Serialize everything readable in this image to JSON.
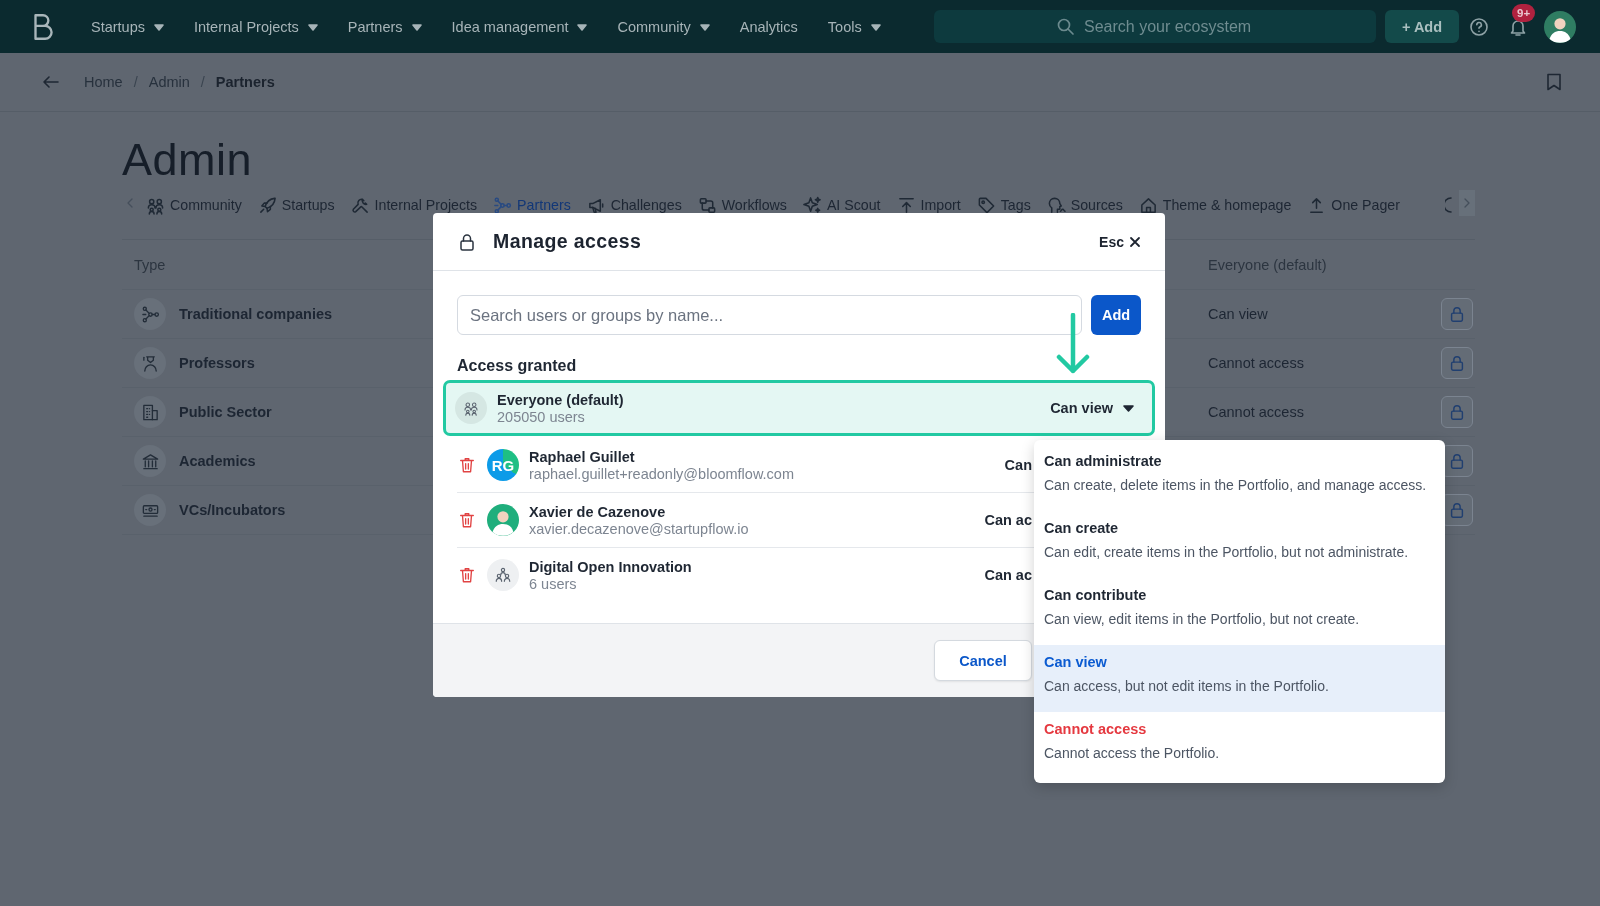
{
  "nav": {
    "menu": [
      {
        "label": "Startups",
        "dropdown": true
      },
      {
        "label": "Internal Projects",
        "dropdown": true
      },
      {
        "label": "Partners",
        "dropdown": true
      },
      {
        "label": "Idea management",
        "dropdown": true
      },
      {
        "label": "Community",
        "dropdown": true
      },
      {
        "label": "Analytics",
        "dropdown": false
      },
      {
        "label": "Tools",
        "dropdown": true
      }
    ],
    "search": {
      "placeholder": "Search your ecosystem"
    },
    "add_button": "+ Add",
    "notification_badge": "9+"
  },
  "breadcrumb": [
    {
      "label": "Home",
      "kind": "link"
    },
    {
      "label": "/",
      "kind": "separator"
    },
    {
      "label": "Admin",
      "kind": "link"
    },
    {
      "label": "/",
      "kind": "separator"
    },
    {
      "label": "Partners",
      "kind": "current"
    }
  ],
  "page_title": "Admin",
  "tabs": [
    {
      "label": "Community",
      "selected": false
    },
    {
      "label": "Startups",
      "selected": false
    },
    {
      "label": "Internal Projects",
      "selected": false
    },
    {
      "label": "Partners",
      "selected": true
    },
    {
      "label": "Challenges",
      "selected": false
    },
    {
      "label": "Workflows",
      "selected": false
    },
    {
      "label": "AI Scout",
      "selected": false
    },
    {
      "label": "Import",
      "selected": false
    },
    {
      "label": "Tags",
      "selected": false
    },
    {
      "label": "Sources",
      "selected": false
    },
    {
      "label": "Theme & homepage",
      "selected": false
    },
    {
      "label": "One Pager",
      "selected": false
    }
  ],
  "table": {
    "columns": [
      "Type",
      "Everyone (default)"
    ],
    "rows": [
      {
        "type": "Traditional companies",
        "access": "Can view"
      },
      {
        "type": "Professors",
        "access": "Cannot access"
      },
      {
        "type": "Public Sector",
        "access": "Cannot access"
      },
      {
        "type": "Academics"
      },
      {
        "type": "VCs/Incubators"
      }
    ]
  },
  "modal": {
    "title": "Manage access",
    "close": "Esc",
    "search": {
      "placeholder": "Search users or groups by name..."
    },
    "add_button": "Add",
    "section_title": "Access granted",
    "entries": [
      {
        "kind": "group",
        "name": "Everyone (default)",
        "detail": "205050 users",
        "access": "Can view",
        "highlighted": true,
        "removable": false
      },
      {
        "kind": "initials",
        "initials": "RG",
        "name": "Raphael Guillet",
        "detail": "raphael.guillet+readonly@bloomflow.com",
        "access": "Can",
        "highlighted": false,
        "removable": true
      },
      {
        "kind": "photo",
        "name": "Xavier de Cazenove",
        "detail": "xavier.decazenove@startupflow.io",
        "access": "Can ac",
        "highlighted": false,
        "removable": true
      },
      {
        "kind": "team",
        "name": "Digital Open Innovation",
        "detail": "6 users",
        "access": "Can ac",
        "highlighted": false,
        "removable": true
      }
    ],
    "cancel_button": "Cancel"
  },
  "access_menu": {
    "options": [
      {
        "label": "Can administrate",
        "description": "Can create, delete items in the Portfolio, and manage access.",
        "kind": "normal",
        "selected": false
      },
      {
        "label": "Can create",
        "description": "Can edit, create items in the Portfolio, but not administrate.",
        "kind": "normal",
        "selected": false
      },
      {
        "label": "Can contribute",
        "description": "Can view, edit items in the Portfolio, but not create.",
        "kind": "normal",
        "selected": false
      },
      {
        "label": "Can view",
        "description": "Can access, but not edit items in the Portfolio.",
        "kind": "normal",
        "selected": true
      },
      {
        "label": "Cannot access",
        "description": "Cannot access the Portfolio.",
        "kind": "danger",
        "selected": false
      }
    ]
  }
}
